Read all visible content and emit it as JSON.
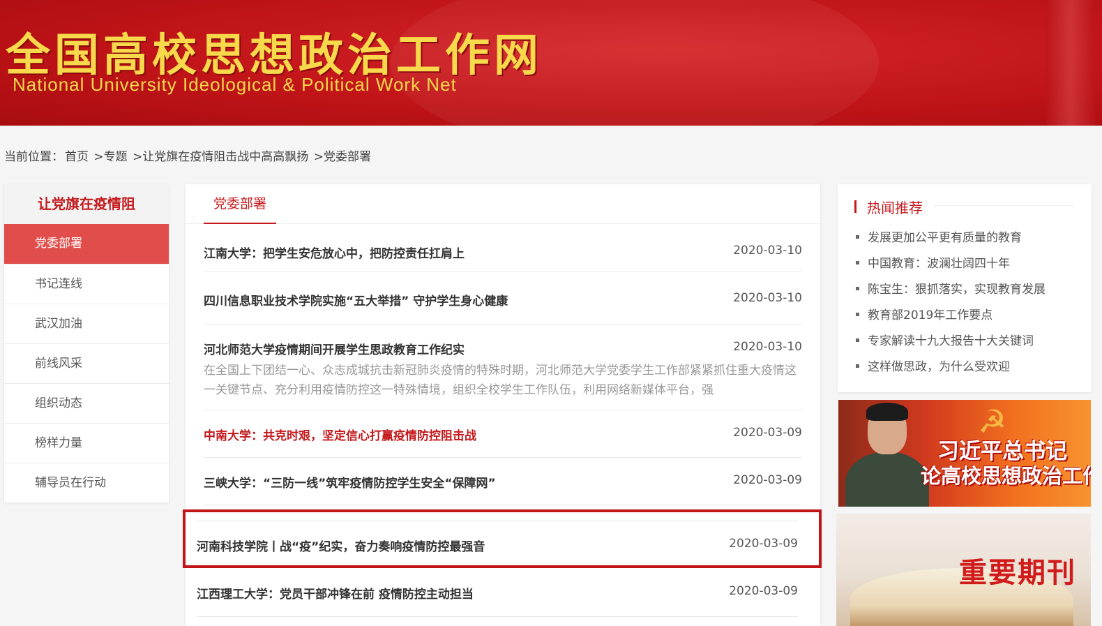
{
  "header": {
    "title_cn": "全国高校思想政治工作网",
    "title_en": "National University Ideological & Political Work Net"
  },
  "breadcrumb": {
    "prefix": "当前位置：",
    "items": [
      "首页",
      ">专题",
      ">让党旗在疫情阻击战中高高飘扬",
      ">党委部署"
    ]
  },
  "sidebar": {
    "title": "让党旗在疫情阻",
    "items": [
      {
        "label": "党委部署",
        "active": true
      },
      {
        "label": "书记连线"
      },
      {
        "label": "武汉加油"
      },
      {
        "label": "前线风采"
      },
      {
        "label": "组织动态"
      },
      {
        "label": "榜样力量"
      },
      {
        "label": "辅导员在行动"
      }
    ]
  },
  "main": {
    "tab": "党委部署",
    "articles": [
      {
        "title": "江南大学：把学生安危放心中，把防控责任扛肩上",
        "date": "2020-03-10"
      },
      {
        "title": "四川信息职业技术学院实施“五大举措” 守护学生身心健康",
        "date": "2020-03-10"
      },
      {
        "title": "河北师范大学疫情期间开展学生思政教育工作纪实",
        "date": "2020-03-10",
        "summary": "在全国上下团结一心、众志成城抗击新冠肺炎疫情的特殊时期，河北师范大学党委学生工作部紧紧抓住重大疫情这一关键节点、充分利用疫情防控这一特殊情境，组织全校学生工作队伍，利用网络新媒体平台，强"
      },
      {
        "title": "中南大学：共克时艰，坚定信心打赢疫情防控阻击战",
        "date": "2020-03-09"
      },
      {
        "title": "三峡大学：“三防一线”筑牢疫情防控学生安全“保障网”",
        "date": "2020-03-09"
      },
      {
        "title": "河南科技学院丨战“疫”纪实，奋力奏响疫情防控最强音",
        "date": "2020-03-09"
      },
      {
        "title": "江西理工大学：党员干部冲锋在前 疫情防控主动担当",
        "date": "2020-03-09"
      }
    ]
  },
  "hot": {
    "heading": "热闻推荐",
    "items": [
      "发展更加公平更有质量的教育",
      "中国教育：波澜壮阔四十年",
      "陈宝生：狠抓落实，实现教育发展",
      "教育部2019年工作要点",
      "专家解读十九大报告十大关键词",
      "这样做思政，为什么受欢迎"
    ]
  },
  "banners": {
    "leader_line1": "习近平总书记",
    "leader_line2": "论高校思想政治工作",
    "journal": "重要期刊"
  },
  "colors": {
    "brand_red": "#c4191c",
    "active_nav": "#e14d4a",
    "logo_gold": "#f7d94b"
  }
}
